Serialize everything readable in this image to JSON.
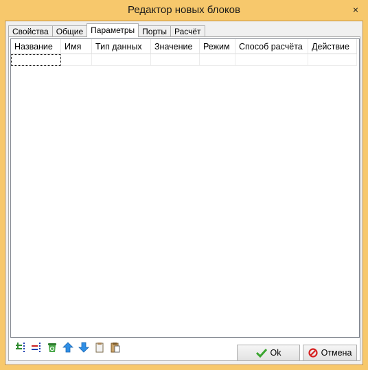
{
  "window": {
    "title": "Редактор новых блоков",
    "close_glyph": "×"
  },
  "tabs": [
    {
      "label": "Свойства",
      "active": false
    },
    {
      "label": "Общие",
      "active": false
    },
    {
      "label": "Параметры",
      "active": true
    },
    {
      "label": "Порты",
      "active": false
    },
    {
      "label": "Расчёт",
      "active": false
    }
  ],
  "grid": {
    "columns": [
      "Название",
      "Имя",
      "Тип данных",
      "Значение",
      "Режим",
      "Способ расчёта",
      "Действие"
    ],
    "rows": [
      [
        "",
        "",
        "",
        "",
        "",
        "",
        ""
      ]
    ]
  },
  "toolbar": {
    "icons": [
      "add-row-icon",
      "delete-row-icon",
      "recycle-bin-icon",
      "arrow-up-icon",
      "arrow-down-icon",
      "copy-icon",
      "paste-icon"
    ]
  },
  "buttons": {
    "ok_label": "Ok",
    "cancel_label": "Отмена"
  },
  "colors": {
    "frame": "#f7c86c",
    "ok_check": "#3aa52f",
    "cancel_icon": "#d62020",
    "arrow": "#2f8fe6",
    "bin": "#3a8c3a"
  }
}
